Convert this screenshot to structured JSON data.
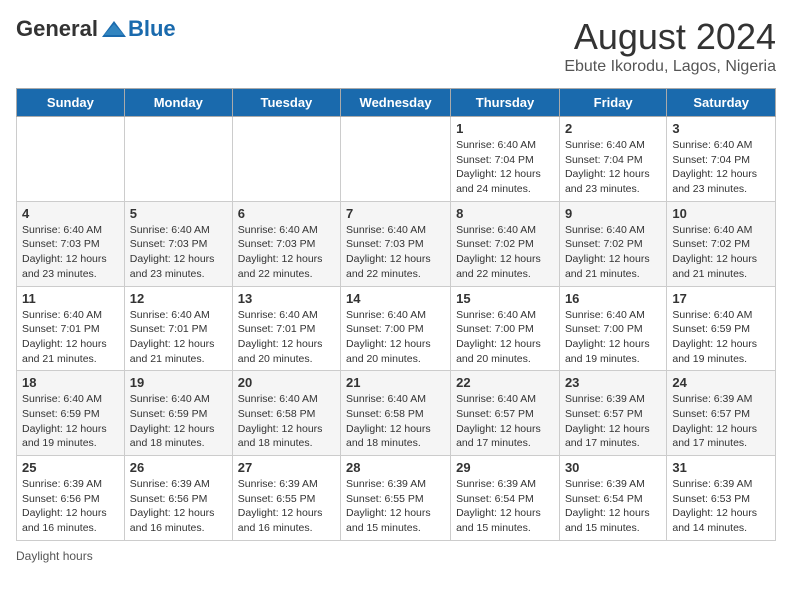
{
  "header": {
    "logo_general": "General",
    "logo_blue": "Blue",
    "title": "August 2024",
    "subtitle": "Ebute Ikorodu, Lagos, Nigeria"
  },
  "days_of_week": [
    "Sunday",
    "Monday",
    "Tuesday",
    "Wednesday",
    "Thursday",
    "Friday",
    "Saturday"
  ],
  "weeks": [
    [
      {
        "day": "",
        "info": ""
      },
      {
        "day": "",
        "info": ""
      },
      {
        "day": "",
        "info": ""
      },
      {
        "day": "",
        "info": ""
      },
      {
        "day": "1",
        "info": "Sunrise: 6:40 AM\nSunset: 7:04 PM\nDaylight: 12 hours and 24 minutes."
      },
      {
        "day": "2",
        "info": "Sunrise: 6:40 AM\nSunset: 7:04 PM\nDaylight: 12 hours and 23 minutes."
      },
      {
        "day": "3",
        "info": "Sunrise: 6:40 AM\nSunset: 7:04 PM\nDaylight: 12 hours and 23 minutes."
      }
    ],
    [
      {
        "day": "4",
        "info": "Sunrise: 6:40 AM\nSunset: 7:03 PM\nDaylight: 12 hours and 23 minutes."
      },
      {
        "day": "5",
        "info": "Sunrise: 6:40 AM\nSunset: 7:03 PM\nDaylight: 12 hours and 23 minutes."
      },
      {
        "day": "6",
        "info": "Sunrise: 6:40 AM\nSunset: 7:03 PM\nDaylight: 12 hours and 22 minutes."
      },
      {
        "day": "7",
        "info": "Sunrise: 6:40 AM\nSunset: 7:03 PM\nDaylight: 12 hours and 22 minutes."
      },
      {
        "day": "8",
        "info": "Sunrise: 6:40 AM\nSunset: 7:02 PM\nDaylight: 12 hours and 22 minutes."
      },
      {
        "day": "9",
        "info": "Sunrise: 6:40 AM\nSunset: 7:02 PM\nDaylight: 12 hours and 21 minutes."
      },
      {
        "day": "10",
        "info": "Sunrise: 6:40 AM\nSunset: 7:02 PM\nDaylight: 12 hours and 21 minutes."
      }
    ],
    [
      {
        "day": "11",
        "info": "Sunrise: 6:40 AM\nSunset: 7:01 PM\nDaylight: 12 hours and 21 minutes."
      },
      {
        "day": "12",
        "info": "Sunrise: 6:40 AM\nSunset: 7:01 PM\nDaylight: 12 hours and 21 minutes."
      },
      {
        "day": "13",
        "info": "Sunrise: 6:40 AM\nSunset: 7:01 PM\nDaylight: 12 hours and 20 minutes."
      },
      {
        "day": "14",
        "info": "Sunrise: 6:40 AM\nSunset: 7:00 PM\nDaylight: 12 hours and 20 minutes."
      },
      {
        "day": "15",
        "info": "Sunrise: 6:40 AM\nSunset: 7:00 PM\nDaylight: 12 hours and 20 minutes."
      },
      {
        "day": "16",
        "info": "Sunrise: 6:40 AM\nSunset: 7:00 PM\nDaylight: 12 hours and 19 minutes."
      },
      {
        "day": "17",
        "info": "Sunrise: 6:40 AM\nSunset: 6:59 PM\nDaylight: 12 hours and 19 minutes."
      }
    ],
    [
      {
        "day": "18",
        "info": "Sunrise: 6:40 AM\nSunset: 6:59 PM\nDaylight: 12 hours and 19 minutes."
      },
      {
        "day": "19",
        "info": "Sunrise: 6:40 AM\nSunset: 6:59 PM\nDaylight: 12 hours and 18 minutes."
      },
      {
        "day": "20",
        "info": "Sunrise: 6:40 AM\nSunset: 6:58 PM\nDaylight: 12 hours and 18 minutes."
      },
      {
        "day": "21",
        "info": "Sunrise: 6:40 AM\nSunset: 6:58 PM\nDaylight: 12 hours and 18 minutes."
      },
      {
        "day": "22",
        "info": "Sunrise: 6:40 AM\nSunset: 6:57 PM\nDaylight: 12 hours and 17 minutes."
      },
      {
        "day": "23",
        "info": "Sunrise: 6:39 AM\nSunset: 6:57 PM\nDaylight: 12 hours and 17 minutes."
      },
      {
        "day": "24",
        "info": "Sunrise: 6:39 AM\nSunset: 6:57 PM\nDaylight: 12 hours and 17 minutes."
      }
    ],
    [
      {
        "day": "25",
        "info": "Sunrise: 6:39 AM\nSunset: 6:56 PM\nDaylight: 12 hours and 16 minutes."
      },
      {
        "day": "26",
        "info": "Sunrise: 6:39 AM\nSunset: 6:56 PM\nDaylight: 12 hours and 16 minutes."
      },
      {
        "day": "27",
        "info": "Sunrise: 6:39 AM\nSunset: 6:55 PM\nDaylight: 12 hours and 16 minutes."
      },
      {
        "day": "28",
        "info": "Sunrise: 6:39 AM\nSunset: 6:55 PM\nDaylight: 12 hours and 15 minutes."
      },
      {
        "day": "29",
        "info": "Sunrise: 6:39 AM\nSunset: 6:54 PM\nDaylight: 12 hours and 15 minutes."
      },
      {
        "day": "30",
        "info": "Sunrise: 6:39 AM\nSunset: 6:54 PM\nDaylight: 12 hours and 15 minutes."
      },
      {
        "day": "31",
        "info": "Sunrise: 6:39 AM\nSunset: 6:53 PM\nDaylight: 12 hours and 14 minutes."
      }
    ]
  ],
  "footer": {
    "daylight_label": "Daylight hours"
  }
}
